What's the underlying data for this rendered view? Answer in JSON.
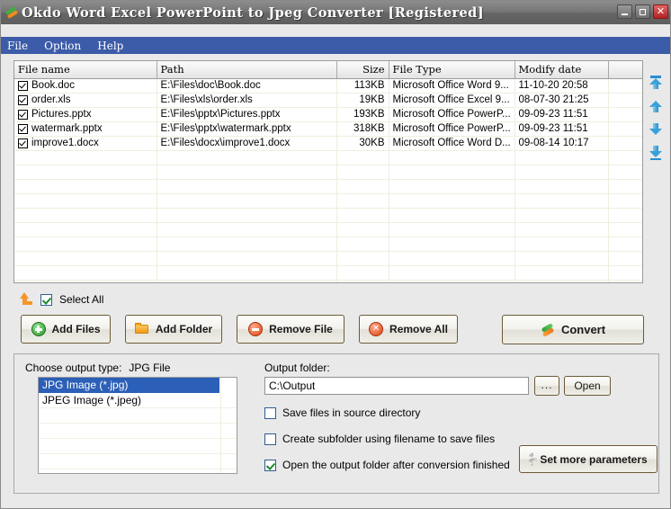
{
  "window": {
    "title": "Okdo Word Excel PowerPoint to Jpeg Converter [Registered]",
    "app_icon": "convert-swoosh-icon",
    "minimize_label": "–",
    "maximize_label": "□",
    "close_label": "✕"
  },
  "menu": {
    "items": [
      {
        "label": "File"
      },
      {
        "label": "Option"
      },
      {
        "label": "Help"
      }
    ]
  },
  "file_list": {
    "columns": [
      "File name",
      "Path",
      "Size",
      "File Type",
      "Modify date",
      ""
    ],
    "rows": [
      {
        "checked": true,
        "name": "Book.doc",
        "path": "E:\\Files\\doc\\Book.doc",
        "size": "113KB",
        "type": "Microsoft Office Word 9...",
        "modified": "11-10-20 20:58"
      },
      {
        "checked": true,
        "name": "order.xls",
        "path": "E:\\Files\\xls\\order.xls",
        "size": "19KB",
        "type": "Microsoft Office Excel 9...",
        "modified": "08-07-30 21:25"
      },
      {
        "checked": true,
        "name": "Pictures.pptx",
        "path": "E:\\Files\\pptx\\Pictures.pptx",
        "size": "193KB",
        "type": "Microsoft Office PowerP...",
        "modified": "09-09-23 11:51"
      },
      {
        "checked": true,
        "name": "watermark.pptx",
        "path": "E:\\Files\\pptx\\watermark.pptx",
        "size": "318KB",
        "type": "Microsoft Office PowerP...",
        "modified": "09-09-23 11:51"
      },
      {
        "checked": true,
        "name": "improve1.docx",
        "path": "E:\\Files\\docx\\improve1.docx",
        "size": "30KB",
        "type": "Microsoft Office Word D...",
        "modified": "09-08-14 10:17"
      }
    ]
  },
  "order_toolbar": {
    "items": [
      {
        "icon": "move-to-top-icon"
      },
      {
        "icon": "move-up-icon"
      },
      {
        "icon": "move-down-icon"
      },
      {
        "icon": "move-to-bottom-icon"
      }
    ]
  },
  "select_all": {
    "icon": "orange-up-arrow-icon",
    "label": "Select All",
    "checked": true
  },
  "toolbar": {
    "add_files_label": "Add Files",
    "add_folder_label": "Add Folder",
    "remove_file_label": "Remove File",
    "remove_all_label": "Remove All",
    "convert_label": "Convert"
  },
  "output": {
    "type_label": "Choose output type:",
    "type_value": "JPG File",
    "type_options": [
      {
        "label": "JPG Image (*.jpg)",
        "selected": true
      },
      {
        "label": "JPEG Image (*.jpeg)",
        "selected": false
      }
    ],
    "folder_label": "Output folder:",
    "folder_value": "C:\\Output",
    "folder_placeholder": "",
    "browse_label": "...",
    "open_label": "Open",
    "options": [
      {
        "label": "Save files in source directory",
        "checked": false
      },
      {
        "label": "Create subfolder using filename to save files",
        "checked": false
      },
      {
        "label": "Open the output folder after conversion finished",
        "checked": true
      }
    ],
    "params_label": "Set more parameters"
  },
  "colors": {
    "titlebar": "#6e6e6e",
    "menubar": "#3c5ba8",
    "selection": "#2b5fb8",
    "accent_orange": "#f5952a",
    "accent_green": "#2c9a2c",
    "background": "#e9e9e9"
  }
}
